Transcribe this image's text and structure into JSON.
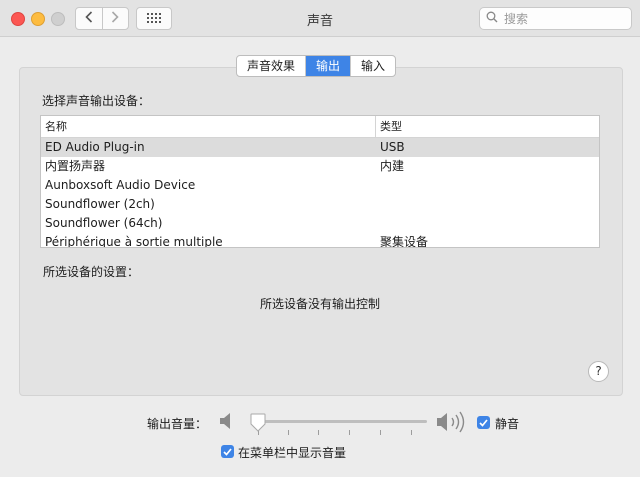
{
  "window": {
    "title": "声音",
    "search_placeholder": "搜索"
  },
  "tabs": [
    {
      "label": "声音效果",
      "active": false
    },
    {
      "label": "输出",
      "active": true
    },
    {
      "label": "输入",
      "active": false
    }
  ],
  "output": {
    "section_label": "选择声音输出设备：",
    "columns": [
      "名称",
      "类型"
    ],
    "devices": [
      {
        "name": "ED Audio Plug-in",
        "type": "USB",
        "selected": true
      },
      {
        "name": "内置扬声器",
        "type": "内建",
        "selected": false
      },
      {
        "name": "Aunboxsoft Audio Device",
        "type": "",
        "selected": false
      },
      {
        "name": "Soundflower (2ch)",
        "type": "",
        "selected": false
      },
      {
        "name": "Soundflower (64ch)",
        "type": "",
        "selected": false
      },
      {
        "name": "Périphérique à sortie multiple",
        "type": "聚集设备",
        "selected": false
      }
    ],
    "settings_label": "所选设备的设置：",
    "no_controls_text": "所选设备没有输出控制",
    "help_label": "?"
  },
  "volume": {
    "label": "输出音量：",
    "level": 0.03,
    "mute_label": "静音",
    "mute_checked": true,
    "show_in_menubar_label": "在菜单栏中显示音量",
    "show_in_menubar_checked": true
  },
  "icons": {
    "back": "chevron-left-icon",
    "forward": "chevron-right-icon",
    "grid": "grid-icon",
    "search": "search-icon",
    "speaker_low": "speaker-low-icon",
    "speaker_high": "speaker-high-icon"
  },
  "colors": {
    "accent": "#3e84e6",
    "close": "#fc5753",
    "minimize": "#fdbc40",
    "zoom_disabled": "#cfcfcf"
  }
}
